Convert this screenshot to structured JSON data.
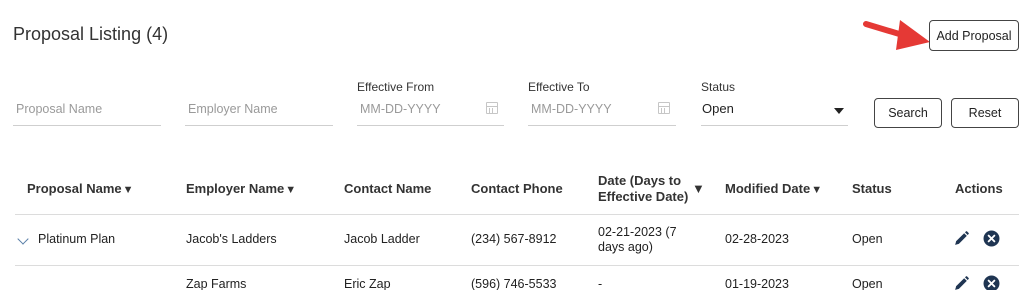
{
  "header": {
    "title": "Proposal Listing (4)",
    "add_label": "Add Proposal",
    "arrow_color": "#e53935"
  },
  "filters": {
    "proposal_name": {
      "placeholder": "Proposal Name"
    },
    "employer_name": {
      "placeholder": "Employer Name"
    },
    "effective_from": {
      "label": "Effective From",
      "placeholder": "MM-DD-YYYY"
    },
    "effective_to": {
      "label": "Effective To",
      "placeholder": "MM-DD-YYYY"
    },
    "status": {
      "label": "Status",
      "value": "Open"
    },
    "search_label": "Search",
    "reset_label": "Reset"
  },
  "table": {
    "columns": {
      "proposal_name": "Proposal Name",
      "employer_name": "Employer Name",
      "contact_name": "Contact Name",
      "contact_phone": "Contact Phone",
      "date_line1": "Date (Days to",
      "date_line2": "Effective Date)",
      "modified_date": "Modified Date",
      "status": "Status",
      "actions": "Actions",
      "sort_glyph": "▼"
    },
    "rows": [
      {
        "proposal_name": "Platinum Plan",
        "employer_name": "Jacob's Ladders",
        "contact_name": "Jacob Ladder",
        "contact_phone": "(234) 567-8912",
        "date_line1": "02-21-2023 (7",
        "date_line2": "days ago)",
        "modified_date": "02-28-2023",
        "status": "Open"
      },
      {
        "proposal_name": "",
        "employer_name": "Zap Farms",
        "contact_name": "Eric Zap",
        "contact_phone": "(596) 746-5533",
        "date_line1": "-",
        "date_line2": "",
        "modified_date": "01-19-2023",
        "status": "Open"
      }
    ]
  },
  "icons": {
    "edit": "pencil-icon",
    "delete": "close-circle-icon",
    "calendar": "calendar-icon",
    "expand": "chevron-down-icon",
    "icon_color": "#1f3552"
  }
}
